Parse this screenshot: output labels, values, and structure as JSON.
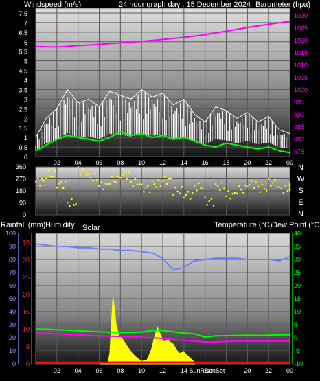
{
  "header": {
    "windspeed_label": "Windspeed (m/s)",
    "title": "24 hour graph day : 15 December 2024",
    "barometer_label": "Barometer (hpa)"
  },
  "lower_labels": {
    "rain": "Rainfall (mm)",
    "humidity": "Humidity",
    "solar": "Solar",
    "temperature": "Temperature (°C)",
    "dewpoint": "Dew Point (°C)",
    "sunrise": "Sun",
    "sunset": "Set"
  },
  "colors": {
    "wind_gust": "#ffffff",
    "wind_avg": "#00ff00",
    "pressure": "#ff00ff",
    "direction": "#ffff00",
    "humidity": "#6f7fff",
    "temperature": "#00ff00",
    "dewpoint": "#ff00ff",
    "solar": "#ffff00",
    "rain": "#ff0000"
  },
  "chart_data": [
    {
      "type": "line",
      "name": "wind_pressure",
      "x_ticks": [
        "02",
        "04",
        "06",
        "08",
        "10",
        "12",
        "14",
        "16",
        "18",
        "20",
        "22",
        "00"
      ],
      "y_left_ticks": [
        "0",
        "0,5",
        "1",
        "1,5",
        "2",
        "2,5",
        "3",
        "3,5",
        "4",
        "4,5",
        "5",
        "5,5",
        "6",
        "6,5",
        "7",
        "7,5"
      ],
      "y_right_ticks": [
        "975",
        "980",
        "985",
        "990",
        "995",
        "1000",
        "1005",
        "1010",
        "1015",
        "1020",
        "1025",
        "1030"
      ],
      "ylim_left": [
        0,
        7.75
      ],
      "ylim_right": [
        973,
        1033
      ],
      "pressure": {
        "x": [
          0,
          2,
          4,
          6,
          8,
          10,
          12,
          14,
          16,
          18,
          20,
          22,
          24
        ],
        "values": [
          1017.5,
          1017.3,
          1017.9,
          1018.4,
          1019.0,
          1019.6,
          1020.4,
          1021.2,
          1022.3,
          1023.7,
          1025.2,
          1026.5,
          1027.7
        ]
      },
      "wind_avg": {
        "x": [
          0,
          1,
          2,
          3,
          4,
          5,
          6,
          7,
          8,
          9,
          10,
          11,
          12,
          13,
          14,
          15,
          16,
          17,
          18,
          19,
          20,
          21,
          22,
          23,
          24
        ],
        "values": [
          0.3,
          0.6,
          0.9,
          1.1,
          1.0,
          0.9,
          0.8,
          1.0,
          1.3,
          1.1,
          1.2,
          1.0,
          1.1,
          0.9,
          1.0,
          0.8,
          0.6,
          0.5,
          0.7,
          0.6,
          0.5,
          0.4,
          0.5,
          0.3,
          0.2
        ]
      },
      "wind_gust": {
        "x": [
          0,
          1,
          2,
          3,
          4,
          5,
          6,
          7,
          8,
          9,
          10,
          11,
          12,
          13,
          14,
          15,
          16,
          17,
          18,
          19,
          20,
          21,
          22,
          23,
          24
        ],
        "values": [
          1.0,
          2.0,
          2.5,
          3.5,
          2.8,
          3.0,
          2.6,
          3.4,
          3.2,
          3.0,
          3.5,
          3.1,
          3.3,
          2.7,
          3.0,
          2.2,
          1.8,
          2.6,
          2.4,
          2.0,
          2.3,
          1.8,
          2.1,
          1.4,
          1.2
        ]
      }
    },
    {
      "type": "scatter",
      "name": "wind_direction",
      "y_ticks": [
        "360",
        "270",
        "180",
        "90",
        "0"
      ],
      "compass_labels": [
        "N",
        "W",
        "S",
        "E",
        "N"
      ],
      "ylim": [
        0,
        360
      ],
      "x": [
        0,
        1,
        2,
        3,
        4,
        5,
        6,
        7,
        8,
        9,
        10,
        11,
        12,
        13,
        14,
        15,
        16,
        17,
        18,
        19,
        20,
        21,
        22,
        23,
        24
      ],
      "values": [
        250,
        300,
        230,
        90,
        330,
        280,
        220,
        260,
        300,
        240,
        200,
        230,
        260,
        180,
        150,
        210,
        100,
        210,
        150,
        190,
        230,
        200,
        240,
        190,
        210
      ]
    },
    {
      "type": "line",
      "name": "temp_humidity_solar_rain",
      "x_ticks": [
        "02",
        "04",
        "06",
        "08",
        "10",
        "12",
        "14",
        "SunRise",
        "SunSet",
        "20",
        "22",
        "00"
      ],
      "y_left_ticks": [
        "0",
        "10",
        "20",
        "30",
        "40",
        "50",
        "60",
        "70",
        "80",
        "90",
        "100"
      ],
      "y_rain_ticks": [
        "0",
        "5",
        "10",
        "15",
        "20",
        "25",
        "30",
        "35"
      ],
      "y_right_ticks": [
        "-10",
        "-5",
        "0",
        "5",
        "10",
        "15",
        "20",
        "25",
        "30",
        "35",
        "40"
      ],
      "ylim_humidity": [
        0,
        100
      ],
      "ylim_temperature": [
        -10,
        40
      ],
      "humidity": {
        "x": [
          0,
          1,
          2,
          3,
          4,
          5,
          6,
          7,
          8,
          9,
          10,
          11,
          12,
          13,
          14,
          15,
          16,
          17,
          18,
          19,
          20,
          21,
          22,
          23,
          24
        ],
        "values": [
          92,
          91,
          90,
          90,
          89,
          89,
          88,
          88,
          87,
          87,
          86,
          85,
          81,
          72,
          74,
          79,
          80,
          81,
          81,
          81,
          80,
          80,
          80,
          79,
          82
        ]
      },
      "temperature": {
        "x": [
          0,
          1,
          2,
          3,
          4,
          5,
          6,
          7,
          8,
          9,
          10,
          11,
          12,
          13,
          14,
          15,
          16,
          17,
          18,
          19,
          20,
          21,
          22,
          23,
          24
        ],
        "values": [
          3.4,
          3.3,
          3.1,
          2.9,
          2.7,
          2.5,
          2.3,
          2.1,
          2.0,
          2.0,
          2.2,
          2.8,
          2.8,
          2.3,
          1.8,
          1.5,
          0.2,
          0.7,
          0.8,
          0.9,
          1.0,
          0.9,
          1.0,
          1.1,
          1.1
        ]
      },
      "dewpoint": {
        "x": [
          0,
          1,
          2,
          3,
          4,
          5,
          6,
          7,
          8,
          9,
          10,
          11,
          12,
          13,
          14,
          15,
          16,
          17,
          18,
          19,
          20,
          21,
          22,
          23,
          24
        ],
        "values": [
          1.8,
          1.7,
          1.5,
          1.3,
          1.1,
          0.9,
          0.7,
          0.6,
          0.5,
          0.4,
          0.2,
          0.0,
          -0.3,
          -0.7,
          -1.0,
          -1.3,
          -1.6,
          -1.6,
          -1.4,
          -1.3,
          -1.2,
          -1.3,
          -1.3,
          -1.2,
          -1.2
        ]
      },
      "solar": {
        "x": [
          6.1,
          6.8,
          7.0,
          7.3,
          7.6,
          7.9,
          8.2,
          8.6,
          9.0,
          9.5,
          10.0,
          10.5,
          10.9,
          11.2,
          11.5,
          11.8,
          12.1,
          12.5,
          13.0,
          13.5,
          14.0,
          14.5,
          14.9,
          15.0
        ],
        "values": [
          0,
          0,
          8,
          52,
          30,
          21,
          19,
          14,
          9,
          5,
          2,
          3,
          10,
          20,
          28,
          22,
          17,
          18,
          15,
          8,
          9,
          5,
          2,
          0
        ]
      },
      "rain": {
        "x": [
          0,
          24
        ],
        "values": [
          0,
          0
        ]
      }
    }
  ]
}
